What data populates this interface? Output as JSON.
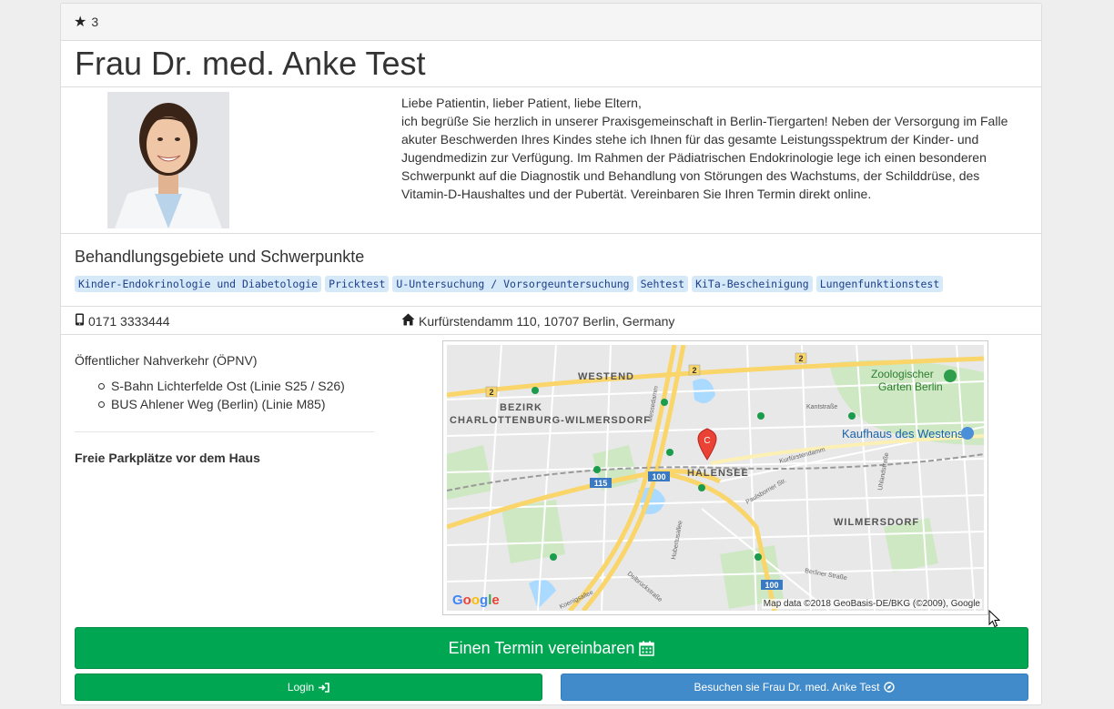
{
  "header": {
    "rating": "3",
    "star_icon": "star-icon"
  },
  "doctor": {
    "name": "Frau Dr. med. Anke Test"
  },
  "intro": {
    "paragraphs": [
      "Liebe Patientin, lieber Patient, liebe Eltern,",
      "ich begrüße Sie herzlich in unserer Praxisgemeinschaft in Berlin-Tiergarten! Neben der Versorgung im Falle akuter Beschwerden Ihres Kindes stehe ich Ihnen für das gesamte Leistungsspektrum der Kinder- und Jugendmedizin zur Verfügung. Im Rahmen der Pädiatrischen Endokrinologie lege ich einen besonderen Schwerpunkt auf die Diagnostik und Behandlung von Störungen des Wachstums, der Schilddrüse, des Vitamin-D-Haushaltes und der Pubertät. Vereinbaren Sie Ihren Termin direkt online."
    ]
  },
  "areas": {
    "title": "Behandlungsgebiete und Schwerpunkte",
    "tags": [
      "Kinder-Endokrinologie und Diabetologie",
      "Pricktest",
      "U-Untersuchung / Vorsorgeuntersuchung",
      "Sehtest",
      "KiTa-Bescheinigung",
      "Lungenfunktionstest"
    ]
  },
  "contact": {
    "phone": "0171 3333444",
    "address": "Kurfürstendamm 110, 10707 Berlin, Germany"
  },
  "transit": {
    "label": "Öffentlicher Nahverkehr (ÖPNV)",
    "items": [
      "S-Bahn Lichterfelde Ost (Linie S25 / S26)",
      "BUS Ahlener Weg (Berlin) (Linie M85)"
    ],
    "parking": "Freie Parkplätze vor dem Haus"
  },
  "map": {
    "labels": {
      "westend": "WESTEND",
      "bezirk": "BEZIRK",
      "cw": "CHARLOTTENBURG-WILMERSDORF",
      "zoo1": "Zoologischer",
      "zoo2": "Garten Berlin",
      "kadewe": "Kaufhaus des Westens",
      "halensee": "HALENSEE",
      "wilmersdorf": "WILMERSDORF",
      "kantstr": "Kantstraße",
      "kudamm": "Kurfürstendamm",
      "messedamm": "Messedamm",
      "uhland": "Uhlandstraße",
      "paulsborner": "Paulsborner Str.",
      "hubertus": "Hubertusallee",
      "delbrueck": "Delbrückstraße",
      "koenigsallee": "Koenigsallee",
      "berliner": "Berliner Straße",
      "marker": "C",
      "r2": "2",
      "r100": "100",
      "r115": "115"
    },
    "google": "Google",
    "attribution": "Map data ©2018 GeoBasis-DE/BKG (©2009), Google"
  },
  "buttons": {
    "appointment": "Einen Termin vereinbaren",
    "login": "Login",
    "visit": "Besuchen sie Frau Dr. med. Anke Test"
  },
  "colors": {
    "primary_green": "#00a651",
    "visit_blue": "#428bca",
    "tag_bg": "#d6e9f8",
    "tag_text": "#1e3f8a",
    "marker_red": "#ea4335"
  }
}
